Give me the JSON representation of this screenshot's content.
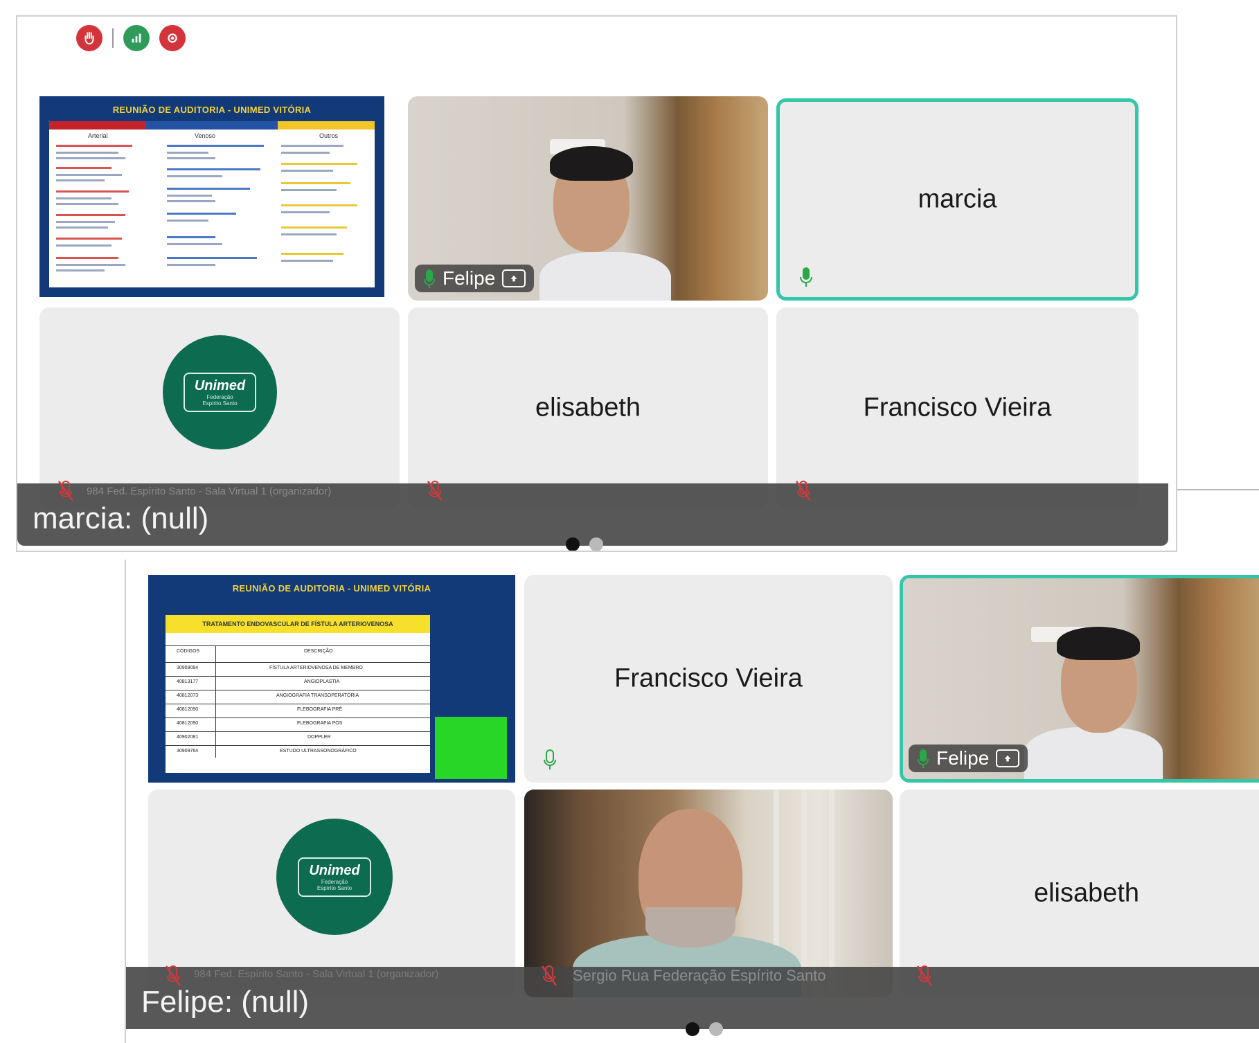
{
  "screen1": {
    "caption": "marcia: (null)",
    "slide": {
      "title": "REUNIÃO DE AUDITORIA - UNIMED VITÓRIA",
      "columns": [
        "Arterial",
        "Venoso",
        "Outros"
      ]
    },
    "tiles": [
      {
        "name": "Felipe"
      },
      {
        "name": "marcia"
      },
      {
        "name": "elisabeth"
      },
      {
        "name": "Francisco Vieira"
      }
    ],
    "organizer_label": "984 Fed. Espírito Santo - Sala Virtual 1 (organizador)",
    "logo": {
      "brand": "Unimed",
      "sub1": "Federação",
      "sub2": "Espírito Santo"
    }
  },
  "screen2": {
    "caption": "Felipe: (null)",
    "slide": {
      "title": "REUNIÃO DE AUDITORIA - UNIMED VITÓRIA",
      "table_title": "TRATAMENTO ENDOVASCULAR DE FÍSTULA ARTERIOVENOSA",
      "headers": [
        "CÓDIGOS",
        "DESCRIÇÃO"
      ],
      "rows": [
        [
          "30909094",
          "FÍSTULA ARTERIOVENOSA DE MEMBRO"
        ],
        [
          "40813177",
          "ANGIOPLASTIA"
        ],
        [
          "40812073",
          "ANGIOGRAFIA TRANSOPERATÓRIA"
        ],
        [
          "40812090",
          "FLEBOGRAFIA PRÉ"
        ],
        [
          "40812090",
          "FLEBOGRAFIA PÓS"
        ],
        [
          "40902081",
          "DOPPLER"
        ],
        [
          "30909764",
          "ESTUDO ULTRASSONOGRÁFICO"
        ]
      ]
    },
    "tiles": [
      {
        "name": "Francisco Vieira"
      },
      {
        "name": "Felipe"
      },
      {
        "name": "Sergio Rua Federação Espírito Santo"
      },
      {
        "name": "elisabeth"
      }
    ],
    "organizer_label": "984 Fed. Espírito Santo - Sala Virtual 1 (organizador)",
    "logo": {
      "brand": "Unimed",
      "sub1": "Federação",
      "sub2": "Espírito Santo"
    }
  },
  "colors": {
    "accent": "#34c6a8",
    "brand_green": "#0d6b4f",
    "mic_muted": "#d0393c",
    "mic_active": "#2aa845"
  },
  "icons": [
    "hand-icon",
    "signal-icon",
    "record-icon",
    "mic-icon",
    "mic-muted-icon",
    "share-up-icon"
  ]
}
